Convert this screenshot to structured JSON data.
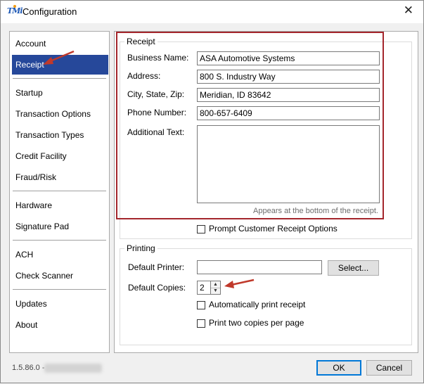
{
  "window": {
    "title": "Configuration",
    "app_icon_text": "TMi",
    "close_icon": "✕"
  },
  "sidebar": {
    "items": [
      {
        "label": "Account"
      },
      {
        "label": "Receipt"
      },
      {
        "label": "Startup"
      },
      {
        "label": "Transaction Options"
      },
      {
        "label": "Transaction Types"
      },
      {
        "label": "Credit Facility"
      },
      {
        "label": "Fraud/Risk"
      },
      {
        "label": "Hardware"
      },
      {
        "label": "Signature Pad"
      },
      {
        "label": "ACH"
      },
      {
        "label": "Check Scanner"
      },
      {
        "label": "Updates"
      },
      {
        "label": "About"
      }
    ],
    "selected": "Receipt"
  },
  "receipt": {
    "group_title": "Receipt",
    "business_name_label": "Business Name:",
    "business_name_value": "ASA Automotive Systems",
    "address_label": "Address:",
    "address_value": "800 S. Industry Way",
    "city_label": "City, State, Zip:",
    "city_value": "Meridian, ID 83642",
    "phone_label": "Phone Number:",
    "phone_value": "800-657-6409",
    "additional_label": "Additional Text:",
    "additional_value": "",
    "hint": "Appears at the bottom of the receipt.",
    "prompt_options_label": "Prompt Customer Receipt Options",
    "prompt_options_checked": false
  },
  "printing": {
    "group_title": "Printing",
    "default_printer_label": "Default Printer:",
    "default_printer_value": "",
    "select_button": "Select...",
    "default_copies_label": "Default Copies:",
    "default_copies_value": "2",
    "auto_print_label": "Automatically print receipt",
    "auto_print_checked": false,
    "two_copies_label": "Print two copies per page",
    "two_copies_checked": false
  },
  "footer": {
    "version": "1.5.86.0 -",
    "ok_button": "OK",
    "cancel_button": "Cancel"
  },
  "colors": {
    "selected_nav": "#26489a",
    "highlight_border": "#a4262c",
    "annotation_arrow": "#c0392b"
  }
}
